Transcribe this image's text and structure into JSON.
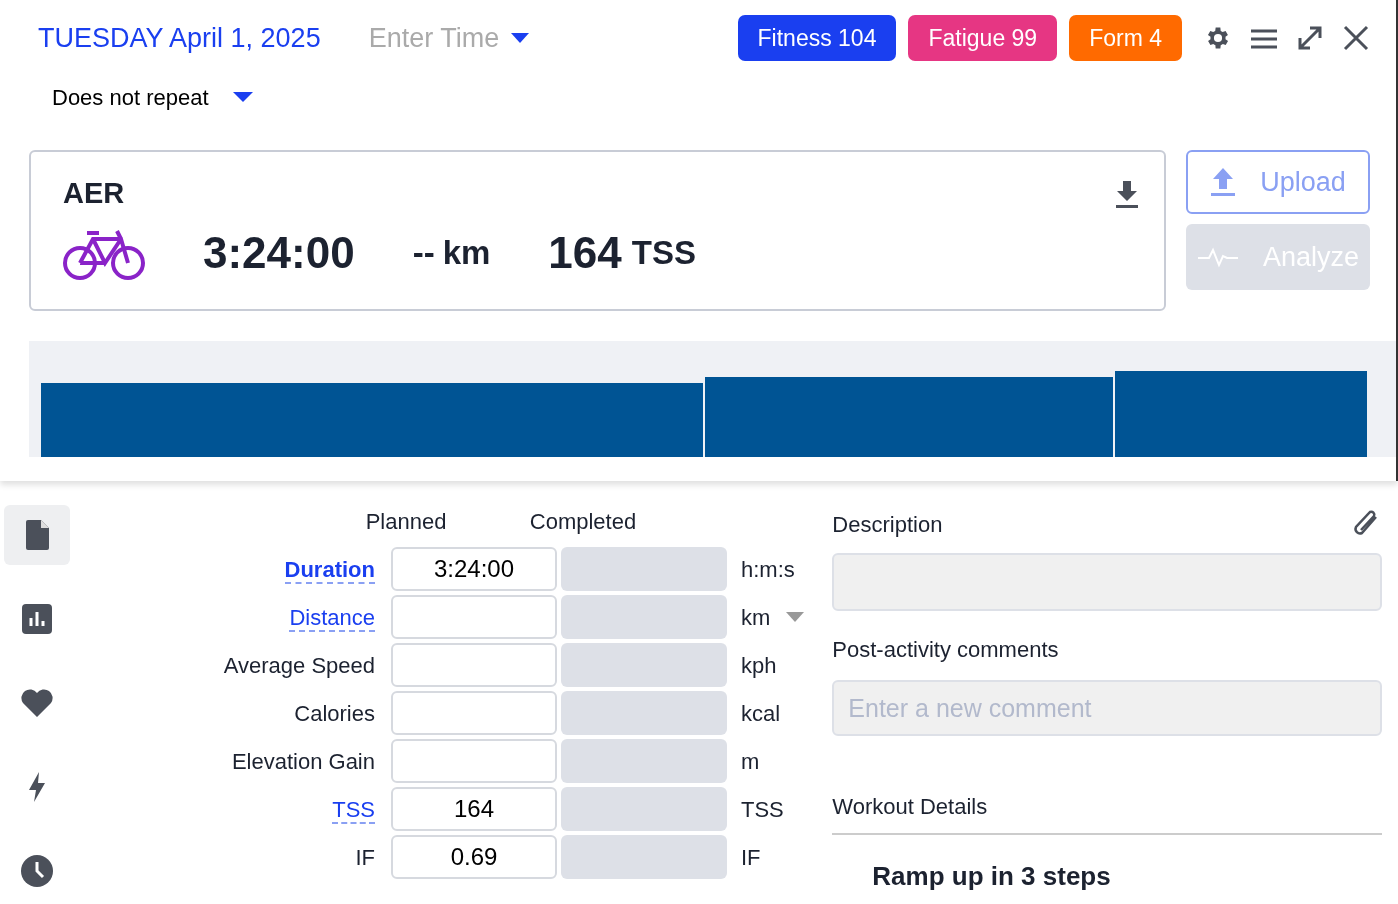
{
  "header": {
    "date": "TUESDAY April 1, 2025",
    "time_placeholder": "Enter Time",
    "badges": [
      {
        "label": "Fitness 104",
        "color": "#1a3ff0"
      },
      {
        "label": "Fatigue 99",
        "color": "#e63683"
      },
      {
        "label": "Form 4",
        "color": "#ff6a00"
      }
    ]
  },
  "repeat": {
    "value": "Does not repeat"
  },
  "workout": {
    "title": "AER",
    "duration": "3:24:00",
    "distance": "--",
    "distance_unit": "km",
    "tss": "164",
    "tss_unit": "TSS"
  },
  "actions": [
    {
      "label": "Upload",
      "disabled": false
    },
    {
      "label": "Analyze",
      "disabled": true
    }
  ],
  "side_tabs": [
    {
      "selected": true
    },
    {
      "selected": false
    },
    {
      "selected": false
    },
    {
      "selected": false
    },
    {
      "selected": false
    }
  ],
  "metrics": {
    "columns": [
      "Planned",
      "Completed"
    ],
    "rows": [
      {
        "label": "Duration",
        "kind": "link-bold",
        "planned": "3:24:00",
        "unit": "h:m:s",
        "unit_dropdown": false
      },
      {
        "label": "Distance",
        "kind": "link",
        "planned": "",
        "unit": "km",
        "unit_dropdown": true
      },
      {
        "label": "Average Speed",
        "kind": "plain",
        "planned": "",
        "unit": "kph",
        "unit_dropdown": false
      },
      {
        "label": "Calories",
        "kind": "plain",
        "planned": "",
        "unit": "kcal",
        "unit_dropdown": false
      },
      {
        "label": "Elevation Gain",
        "kind": "plain",
        "planned": "",
        "unit": "m",
        "unit_dropdown": false
      },
      {
        "label": "TSS",
        "kind": "link",
        "planned": "164",
        "unit": "TSS",
        "unit_dropdown": false
      },
      {
        "label": "IF",
        "kind": "plain",
        "planned": "0.69",
        "unit": "IF",
        "unit_dropdown": false
      }
    ]
  },
  "description": {
    "label": "Description"
  },
  "comments": {
    "label": "Post-activity comments",
    "placeholder": "Enter a new comment"
  },
  "workout_details": {
    "label": "Workout Details",
    "step_title": "Ramp up in 3 steps"
  }
}
